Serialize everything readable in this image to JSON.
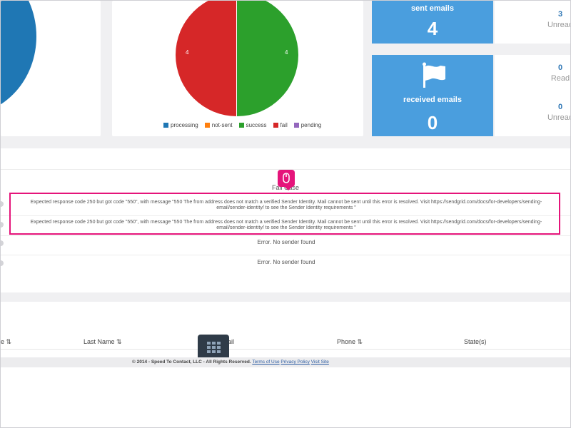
{
  "dashboard": {
    "status_pie": {
      "left_value": "4",
      "right_value": "4",
      "legend": [
        {
          "label": "processing",
          "color": "#1f77b4"
        },
        {
          "label": "not-sent",
          "color": "#ff7f0e"
        },
        {
          "label": "success",
          "color": "#2ca02c"
        },
        {
          "label": "fail",
          "color": "#d62728"
        },
        {
          "label": "pending",
          "color": "#9467bd"
        }
      ]
    },
    "sent": {
      "label": "sent emails",
      "count": "4",
      "unread_value": "3",
      "unread_label": "Unread"
    },
    "received": {
      "label": "received emails",
      "count": "0",
      "read_value": "0",
      "read_label": "Read",
      "unread_value": "0",
      "unread_label": "Unread"
    }
  },
  "fail_table": {
    "header": "Fail Case",
    "rows": [
      "Expected response code 250 but got code \"550\", with message \"550 The from address does not match a verified Sender Identity. Mail cannot be sent until this error is resolved. Visit https://sendgrid.com/docs/for-developers/sending-email/sender-identity/ to see the Sender Identity requirements \"",
      "Expected response code 250 but got code \"550\", with message \"550 The from address does not match a verified Sender Identity. Mail cannot be sent until this error is resolved. Visit https://sendgrid.com/docs/for-developers/sending-email/sender-identity/ to see the Sender Identity requirements \"",
      "Error. No sender found",
      "Error. No sender found"
    ]
  },
  "contacts_table": {
    "columns": [
      "e",
      "Last Name",
      "ail",
      "Phone",
      "State(s)"
    ]
  },
  "footer": {
    "copyright": "© 2014 - Speed To Contact, LLC - All Rights Reserved.",
    "links": [
      "Terms of Use",
      "Privacy Policy",
      "Visit Site"
    ]
  },
  "colors": {
    "accent": "#4a9ede",
    "highlight": "#e5147a",
    "link": "#337ab7"
  }
}
